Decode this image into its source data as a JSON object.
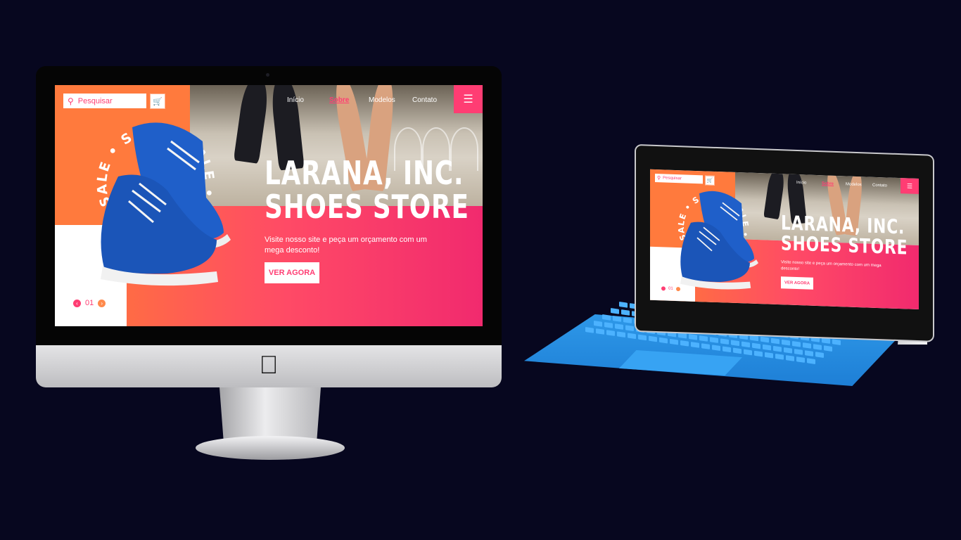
{
  "site": {
    "search_placeholder": "Pesquisar",
    "nav": [
      "Início",
      "Sobre",
      "Modelos",
      "Contato"
    ],
    "active_nav": "Sobre",
    "menu_glyph": "☰",
    "headline_line1": "LARANA, INC.",
    "headline_line2": "SHOES STORE",
    "subtitle": "Visite nosso site e peça um orçamento com um mega desconto!",
    "cta": "VER AGORA",
    "page_number": "01",
    "badge_text": "SALE • SALE • SALE •"
  },
  "devices": {
    "monitor_logo": "apple-logo-icon",
    "tablet_keyboard_color": "#2e98e8"
  },
  "colors": {
    "background": "#07071f",
    "accent_pink": "#ff3d73",
    "accent_orange": "#ff7a3d",
    "shoe_blue": "#1f5fc9"
  }
}
